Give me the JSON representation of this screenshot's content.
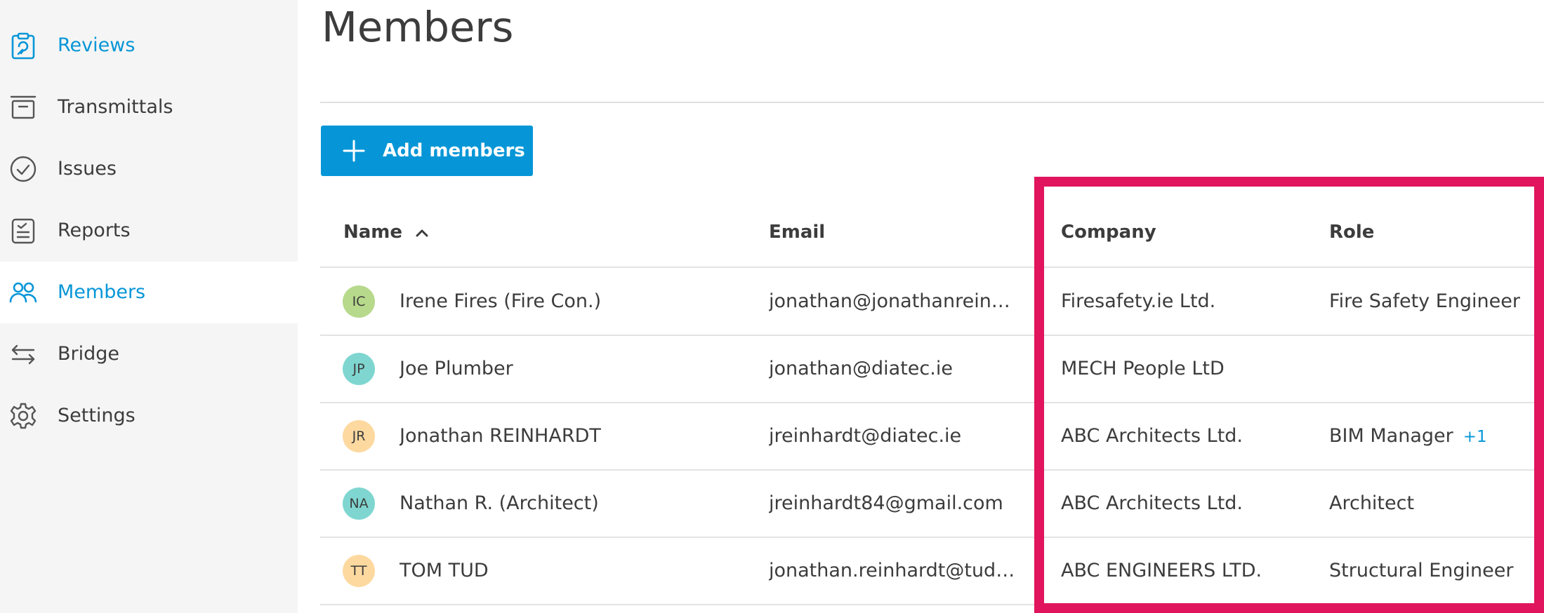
{
  "sidebar": {
    "items": [
      {
        "label": "Reviews",
        "icon": "clipboard-check-icon",
        "highlighted": true,
        "active": false
      },
      {
        "label": "Transmittals",
        "icon": "archive-box-icon",
        "highlighted": false,
        "active": false
      },
      {
        "label": "Issues",
        "icon": "check-circle-icon",
        "highlighted": false,
        "active": false
      },
      {
        "label": "Reports",
        "icon": "report-clipboard-icon",
        "highlighted": false,
        "active": false
      },
      {
        "label": "Members",
        "icon": "people-icon",
        "highlighted": true,
        "active": true
      },
      {
        "label": "Bridge",
        "icon": "swap-arrows-icon",
        "highlighted": false,
        "active": false
      },
      {
        "label": "Settings",
        "icon": "gear-icon",
        "highlighted": false,
        "active": false
      }
    ]
  },
  "header": {
    "title": "Members"
  },
  "toolbar": {
    "add_label": "Add members"
  },
  "table": {
    "columns": {
      "name": "Name",
      "email": "Email",
      "company": "Company",
      "role": "Role"
    },
    "sort": {
      "column": "Name",
      "direction": "ascending"
    },
    "rows": [
      {
        "initials": "IC",
        "avatar_color": "#b7d98b",
        "name": "Irene Fires (Fire Con.)",
        "email": "jonathan@jonathanrein…",
        "company": "Firesafety.ie Ltd.",
        "role": "Fire Safety Engineer",
        "role_extra": ""
      },
      {
        "initials": "JP",
        "avatar_color": "#7fd6d0",
        "name": "Joe Plumber",
        "email": "jonathan@diatec.ie",
        "company": "MECH People LtD",
        "role": "",
        "role_extra": ""
      },
      {
        "initials": "JR",
        "avatar_color": "#fdd9a0",
        "name": "Jonathan REINHARDT",
        "email": "jreinhardt@diatec.ie",
        "company": "ABC Architects Ltd.",
        "role": "BIM Manager",
        "role_extra": "+1"
      },
      {
        "initials": "NA",
        "avatar_color": "#7fd6d0",
        "name": "Nathan R. (Architect)",
        "email": "jreinhardt84@gmail.com",
        "company": "ABC Architects Ltd.",
        "role": "Architect",
        "role_extra": ""
      },
      {
        "initials": "TT",
        "avatar_color": "#fdd9a0",
        "name": "TOM TUD",
        "email": "jonathan.reinhardt@tud…",
        "company": "ABC ENGINEERS LTD.",
        "role": "Structural Engineer",
        "role_extra": ""
      }
    ]
  },
  "colors": {
    "accent": "#0696d7",
    "highlight_box": "#e0155d",
    "sidebar_bg": "#f5f5f5"
  }
}
